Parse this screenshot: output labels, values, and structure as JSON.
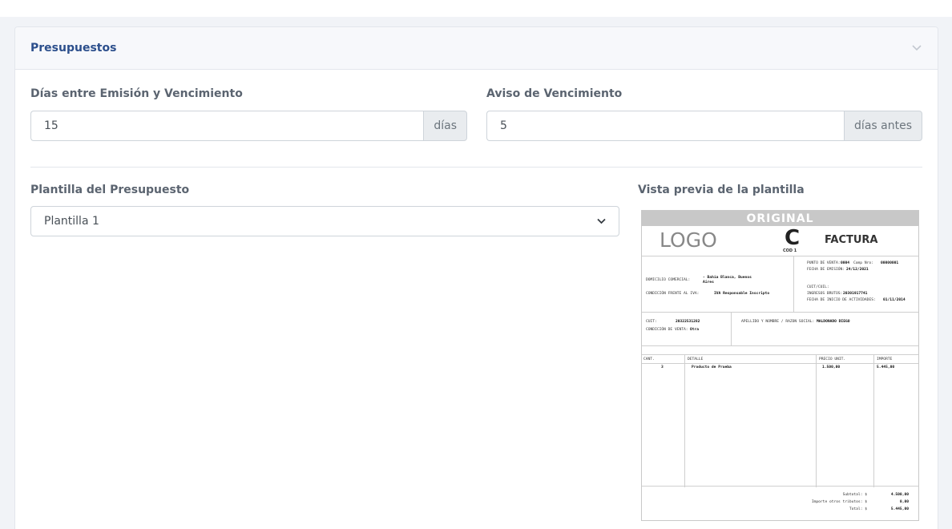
{
  "panel": {
    "title": "Presupuestos",
    "chevron_icon": "chevron-down-icon"
  },
  "fields": {
    "dias_emision": {
      "label": "Días entre Emisión y Vencimiento",
      "value": "15",
      "addon": "días"
    },
    "aviso": {
      "label": "Aviso de Vencimiento",
      "value": "5",
      "addon": "días antes"
    },
    "plantilla": {
      "label": "Plantilla del Presupuesto",
      "selected": "Plantilla 1"
    },
    "preview_label": "Vista previa de la plantilla"
  },
  "preview": {
    "band": "ORIGINAL",
    "logo": "LOGO",
    "letter": "C",
    "cod": "COD 1",
    "doc_type": "FACTURA",
    "punto_venta_label": "PUNTO DE VENTA:",
    "punto_venta": "0004",
    "comp_nro_label": "Comp Nro:",
    "comp_nro": "00000001",
    "fecha_emision_label": "FECHA DE EMISIÓN:",
    "fecha_emision": "24/12/2021",
    "domicilio_label": "DOMICILIO COMERCIAL:",
    "domicilio_1": "- Bahía Blanca, Buenos",
    "domicilio_2": "Aires",
    "iva_label": "CONDICIÓN FRENTE AL IVA:",
    "iva": "IVA Responsable Inscripto",
    "cuit_emisor_label": "CUIT/CUIL:",
    "ingresos_label": "INGRESOS BRUTOS:",
    "ingresos": "20301917741",
    "inicio_label": "FECHA DE INICIO DE ACTIVIDADES:",
    "inicio": "01/11/2014",
    "cuit_label": "CUIT:",
    "cuit": "20322531282",
    "apellido_label": "APELLIDO Y NOMBRE / RAZON SOCIAL:",
    "apellido": "MALDONADO DIEGO",
    "cond_venta_label": "CONDICIÓN DE VENTA:",
    "cond_venta": "Otra",
    "columns": [
      "CANT.",
      "DETALLE",
      "PRECIO UNIT.",
      "IMPORTE"
    ],
    "rows": [
      {
        "cant": "3",
        "detalle": "Producto de Prueba",
        "precio": "1.500,00",
        "importe": "5.445,00"
      }
    ],
    "subtotal_label": "Subtotal: $",
    "subtotal": "4.500,00",
    "otros_label": "Importe otros tributos: $",
    "otros": "0,00",
    "total_label": "Total: $",
    "total": "5.445,00"
  }
}
